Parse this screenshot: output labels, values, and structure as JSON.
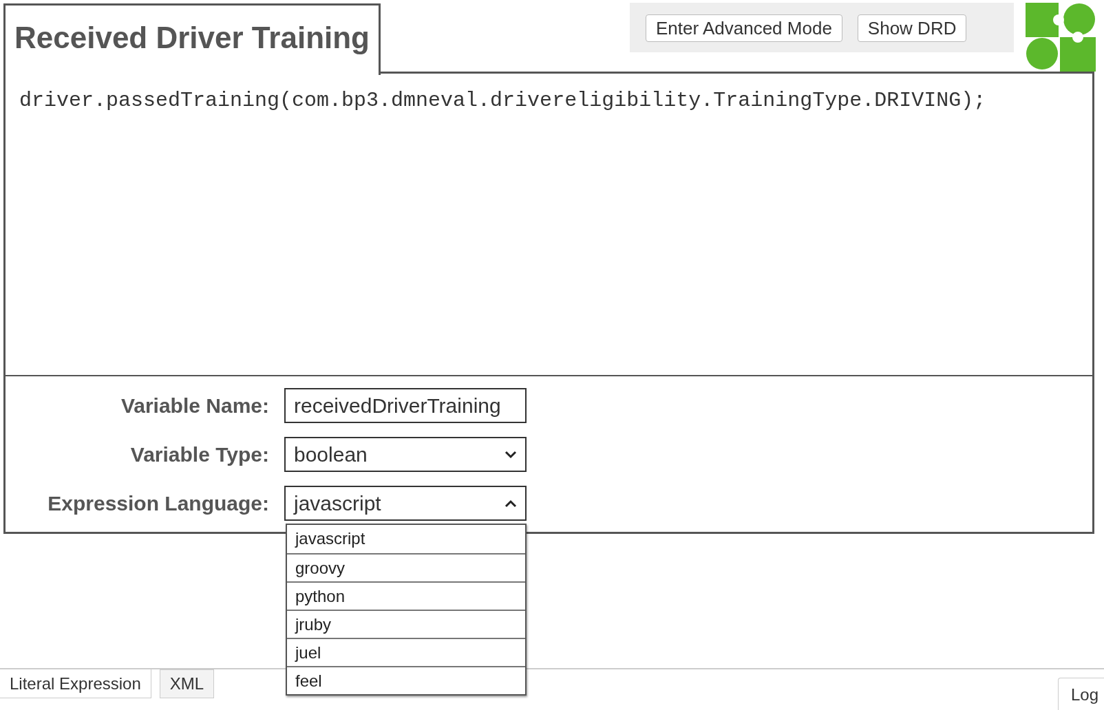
{
  "header": {
    "title": "Received Driver Training",
    "buttons": [
      "Enter Advanced Mode",
      "Show DRD"
    ]
  },
  "editor": {
    "code": "driver.passedTraining(com.bp3.dmneval.drivereligibility.TrainingType.DRIVING);"
  },
  "form": [
    {
      "kind": "input",
      "label": "Variable Name:",
      "value": "receivedDriverTraining"
    },
    {
      "kind": "select",
      "label": "Variable Type:",
      "value": "boolean",
      "expanded": false
    },
    {
      "kind": "select",
      "label": "Expression Language:",
      "value": "javascript",
      "expanded": true,
      "options": [
        "javascript",
        "groovy",
        "python",
        "jruby",
        "juel",
        "feel"
      ]
    }
  ],
  "tabs": [
    {
      "label": "Literal Expression",
      "selected": true
    },
    {
      "label": "XML",
      "selected": false
    }
  ],
  "log_button": "Log"
}
